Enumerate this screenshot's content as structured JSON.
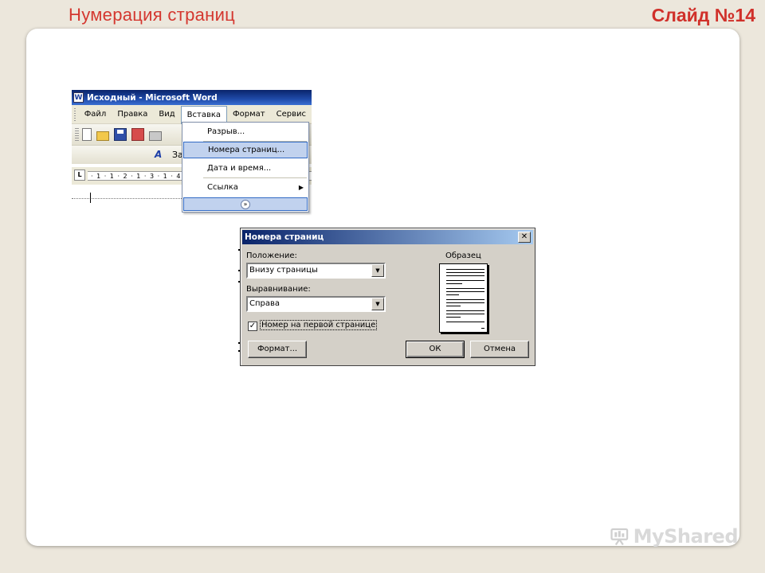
{
  "slide": {
    "title": "Нумерация страниц",
    "number": "Слайд №14"
  },
  "word": {
    "window_title": "Исходный - Microsoft Word",
    "menu": [
      "Файл",
      "Правка",
      "Вид",
      "Вставка",
      "Формат",
      "Сервис"
    ],
    "open_menu": "Вставка",
    "style_text": "За",
    "ruler_text": "· 1 · 1 · 2 · 1 · 3 · 1 · 4"
  },
  "insert_menu": {
    "items": [
      {
        "label": "Разрыв..."
      },
      {
        "label": "Номера страниц...",
        "highlighted": true
      },
      {
        "label": "Дата и время..."
      },
      {
        "label": "Ссылка",
        "submenu": true
      }
    ],
    "expand_icon": "double-chevron-down-icon"
  },
  "dialog": {
    "title": "Номера страниц",
    "position_label": "Положение:",
    "position_value": "Внизу страницы",
    "alignment_label": "Выравнивание:",
    "alignment_value": "Справа",
    "first_page_label": "Номер на первой странице",
    "first_page_checked": true,
    "preview_label": "Образец",
    "format_button": "Формат...",
    "ok_button": "ОК",
    "cancel_button": "Отмена"
  },
  "watermark": {
    "text": "MyShared"
  },
  "colors": {
    "title_red": "#d4372f",
    "titlebar_blue": "#0a246a",
    "menu_highlight": "#c1d2ee",
    "dialog_gray": "#d4d0c8"
  }
}
